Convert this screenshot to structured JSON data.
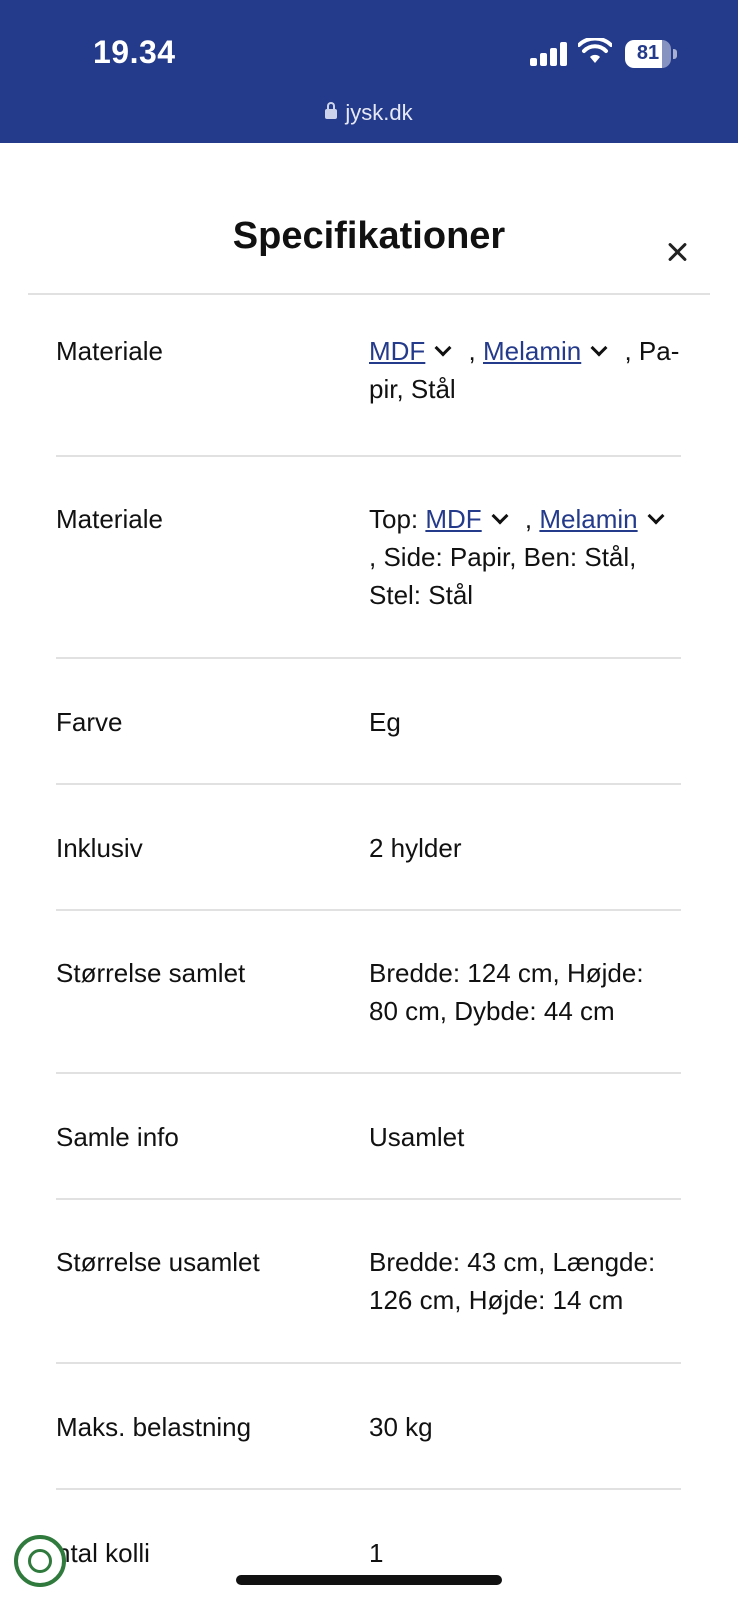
{
  "status_bar": {
    "time": "19.34",
    "battery": "81",
    "battery_level": 0.81,
    "url": "jysk.dk"
  },
  "modal": {
    "title": "Specifikationer",
    "rows": [
      {
        "label": "Materiale",
        "parts": {
          "a": "MDF",
          "b": " , ",
          "c": "Melamin",
          "d": " , Pa-",
          "e": "pir, Stål"
        }
      },
      {
        "label": "Materiale",
        "parts": {
          "a": "Top: ",
          "b": "MDF",
          "c": " , ",
          "d": "Melamin",
          "e": ", Side: Papir, Ben: Stål,",
          "f": "Stel: Stål"
        }
      },
      {
        "label": "Farve",
        "value": "Eg"
      },
      {
        "label": "Inklusiv",
        "value": "2 hylder"
      },
      {
        "label": "Størrelse samlet",
        "value1": "Bredde: 124 cm, Højde:",
        "value2": "80 cm, Dybde: 44 cm"
      },
      {
        "label": "Samle info",
        "value": "Usamlet"
      },
      {
        "label": "Størrelse usamlet",
        "value1": "Bredde: 43 cm, Længde:",
        "value2": "126 cm, Højde: 14 cm"
      },
      {
        "label": "Maks. belastning",
        "value": "30 kg"
      },
      {
        "label": "ntal kolli",
        "value": "1"
      }
    ]
  }
}
